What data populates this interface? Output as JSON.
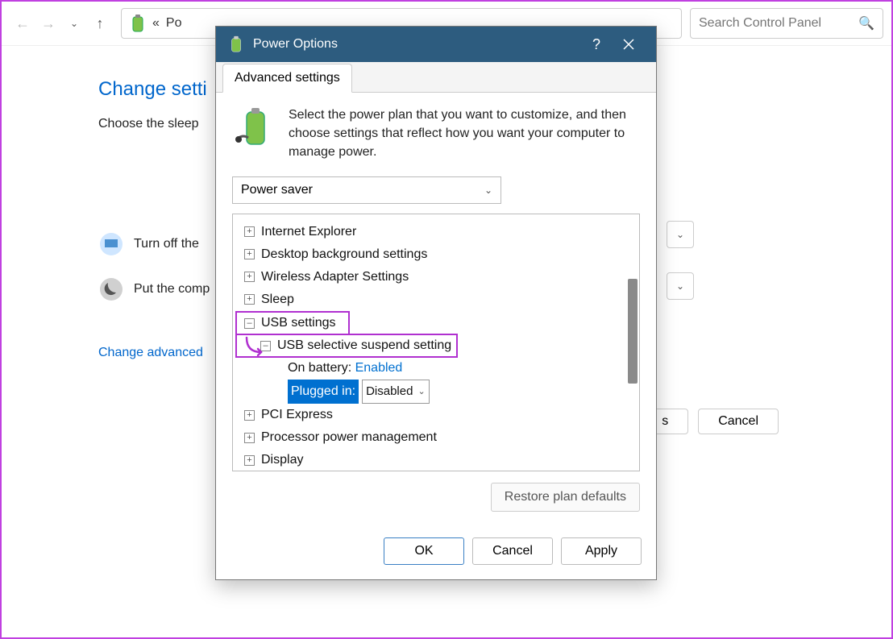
{
  "nav": {
    "breadcrumb_prefix": "«",
    "breadcrumb": "Po"
  },
  "search": {
    "placeholder": "Search Control Panel"
  },
  "page": {
    "title": "Change setti",
    "subtitle": "Choose the sleep",
    "row1": "Turn off the ",
    "row2": "Put the comp",
    "link": "Change advanced",
    "save": "s",
    "cancel": "Cancel"
  },
  "dialog": {
    "title": "Power Options",
    "tab": "Advanced settings",
    "intro": "Select the power plan that you want to customize, and then choose settings that reflect how you want your computer to manage power.",
    "plan": "Power saver",
    "tree": {
      "ie": "Internet Explorer",
      "desktop": "Desktop background settings",
      "wireless": "Wireless Adapter Settings",
      "sleep": "Sleep",
      "usb": "USB settings",
      "usb_sel": "USB selective suspend setting",
      "on_batt_label": "On battery:",
      "on_batt_value": "Enabled",
      "plugged_label": "Plugged in:",
      "plugged_value": "Disabled",
      "pci": "PCI Express",
      "proc": "Processor power management",
      "display": "Display"
    },
    "restore": "Restore plan defaults",
    "ok": "OK",
    "cancel": "Cancel",
    "apply": "Apply"
  }
}
